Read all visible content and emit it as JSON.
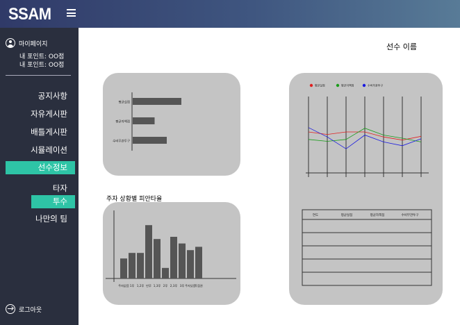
{
  "header": {
    "logo": "SSAM",
    "menu_icon": "hamburger-icon"
  },
  "sidebar": {
    "mypage_label": "마이페이지",
    "points": [
      "내 포인트: OO점",
      "내 포인트: OO점"
    ],
    "nav": [
      "공지사항",
      "자유게시판",
      "배틀게시판",
      "시뮬레이션"
    ],
    "active_nav": "선수정보",
    "sub_nav": [
      "타자"
    ],
    "active_sub": "투수",
    "sub_nav_after": [
      "나만의 팀"
    ],
    "logout_label": "로그아웃"
  },
  "main": {
    "player_name": "선수 이름",
    "situation_title": "주자 상황별 피안타율"
  },
  "chart_data": [
    {
      "type": "bar",
      "orientation": "horizontal",
      "categories": [
        "평균실점",
        "평균자책점",
        "수비무관투구"
      ],
      "values": [
        100,
        45,
        70
      ],
      "grid": false
    },
    {
      "type": "bar",
      "categories": [
        "주자없음",
        "1루",
        "1,2루",
        "만루",
        "1,3루",
        "2루",
        "2,3루",
        "3루",
        "주자있음",
        "득점권"
      ],
      "values": [
        36,
        46,
        46,
        96,
        71,
        19,
        75,
        63,
        51,
        57
      ],
      "grid": false
    },
    {
      "type": "line",
      "series": [
        {
          "name": "평균실점",
          "color": "#e02020",
          "values": [
            50,
            46,
            50,
            50,
            42,
            37,
            43
          ]
        },
        {
          "name": "평균자책점",
          "color": "#1a9c1a",
          "values": [
            38,
            35,
            38,
            56,
            45,
            40,
            34
          ]
        },
        {
          "name": "수비무관투구",
          "color": "#1a1ae0",
          "values": [
            57,
            42,
            23,
            45,
            34,
            28,
            39
          ]
        }
      ],
      "grid": true,
      "legend": "top-left"
    },
    {
      "type": "table",
      "columns": [
        "연도",
        "평균실점",
        "평균자책점",
        "수비무관투구"
      ],
      "rows": [
        [
          "",
          "",
          "",
          ""
        ],
        [
          "",
          "",
          "",
          ""
        ],
        [
          "",
          "",
          "",
          ""
        ],
        [
          "",
          "",
          "",
          ""
        ],
        [
          "",
          "",
          "",
          ""
        ]
      ]
    }
  ]
}
